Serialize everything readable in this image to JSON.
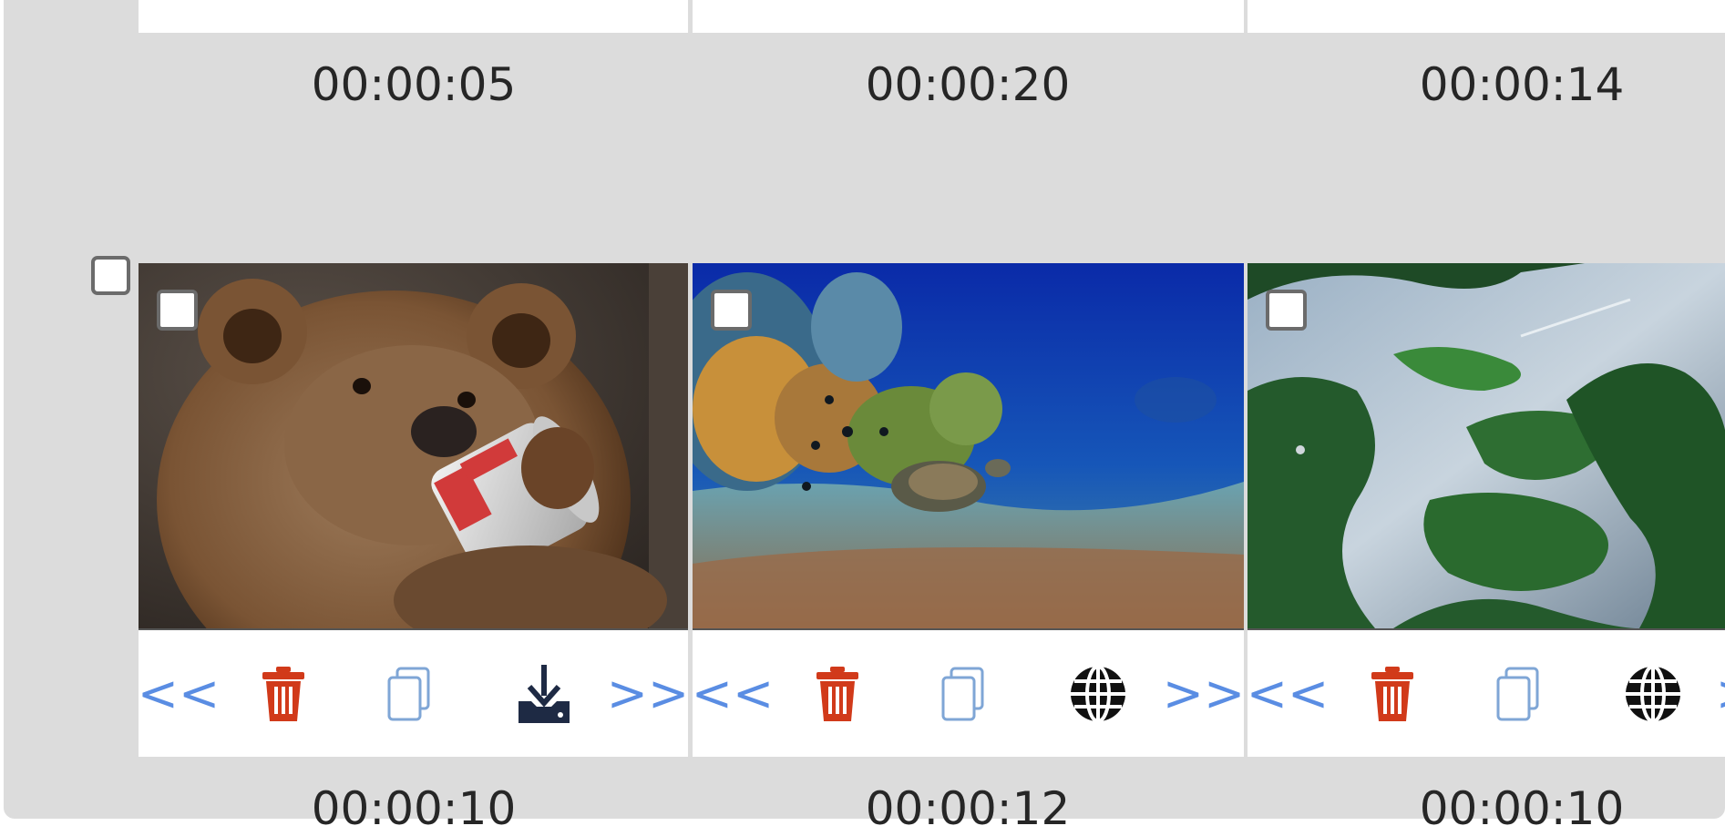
{
  "cards_top_durations": [
    "00:00:05",
    "00:00:20",
    "00:00:14"
  ],
  "cards": [
    {
      "duration": "00:00:10",
      "thumbnail": "bear-drinking-can",
      "actions": {
        "prev": "<<",
        "delete": "trash-icon",
        "copy": "copy-icon",
        "extra": "download-icon",
        "next": ">>"
      }
    },
    {
      "duration": "00:00:12",
      "thumbnail": "sea-turtle-reef",
      "actions": {
        "prev": "<<",
        "delete": "trash-icon",
        "copy": "copy-icon",
        "extra": "globe-icon",
        "next": ">>"
      }
    },
    {
      "duration": "00:00:10",
      "thumbnail": "aerial-islands-lake",
      "actions": {
        "prev": "<<",
        "delete": "trash-icon",
        "copy": "copy-icon",
        "extra": "globe-icon",
        "next": ">>"
      }
    }
  ],
  "colors": {
    "panel_bg": "#dcdcdc",
    "nav_arrows": "#5a8de3",
    "delete_icon": "#d13a1a",
    "copy_icon": "#7fa6d6",
    "download_icon": "#1e2a44",
    "globe_icon": "#111111"
  }
}
